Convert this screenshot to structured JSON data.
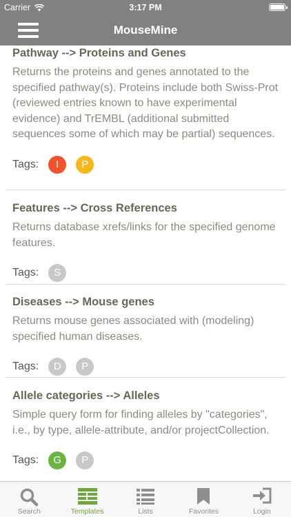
{
  "status_bar": {
    "carrier": "Carrier",
    "time": "3:17 PM"
  },
  "nav": {
    "title": "MouseMine"
  },
  "templates": [
    {
      "title": "Pathway --> Proteins and Genes",
      "description": "Returns the proteins and genes annotated to the specified pathway(s). Proteins include both Swiss-Prot (reviewed entries known to have experimental evidence) and TrEMBL (additional submitted sequences some of which may be partial) sequences.",
      "tags_label": "Tags:",
      "tags": [
        {
          "letter": "I",
          "color": "#f0532b"
        },
        {
          "letter": "P",
          "color": "#f5b81a"
        }
      ]
    },
    {
      "title": "Features --> Cross References",
      "description": "Returns database xrefs/links for the specified genome features.",
      "tags_label": "Tags:",
      "tags": [
        {
          "letter": "S",
          "color": "#c8c8c8"
        }
      ]
    },
    {
      "title": "Diseases --> Mouse genes",
      "description": "Returns mouse genes associated with (modeling) specified human diseases.",
      "tags_label": "Tags:",
      "tags": [
        {
          "letter": "D",
          "color": "#c8c8c8"
        },
        {
          "letter": "P",
          "color": "#c8c8c8"
        }
      ]
    },
    {
      "title": "Allele categories --> Alleles",
      "description": "Simple query form for finding alleles by \"categories\", i.e., by type, allele-attribute, and/or projectCollection.",
      "tags_label": "Tags:",
      "tags": [
        {
          "letter": "G",
          "color": "#6ab53f"
        },
        {
          "letter": "P",
          "color": "#c8c8c8"
        }
      ]
    }
  ],
  "tab_bar": {
    "active_color": "#6fa73d",
    "inactive_color": "#8e8e8e",
    "tabs": [
      {
        "label": "Search",
        "icon": "search-icon"
      },
      {
        "label": "Templates",
        "icon": "templates-icon"
      },
      {
        "label": "Lists",
        "icon": "list-icon"
      },
      {
        "label": "Favorites",
        "icon": "bookmark-icon"
      },
      {
        "label": "Login",
        "icon": "login-icon"
      }
    ]
  }
}
